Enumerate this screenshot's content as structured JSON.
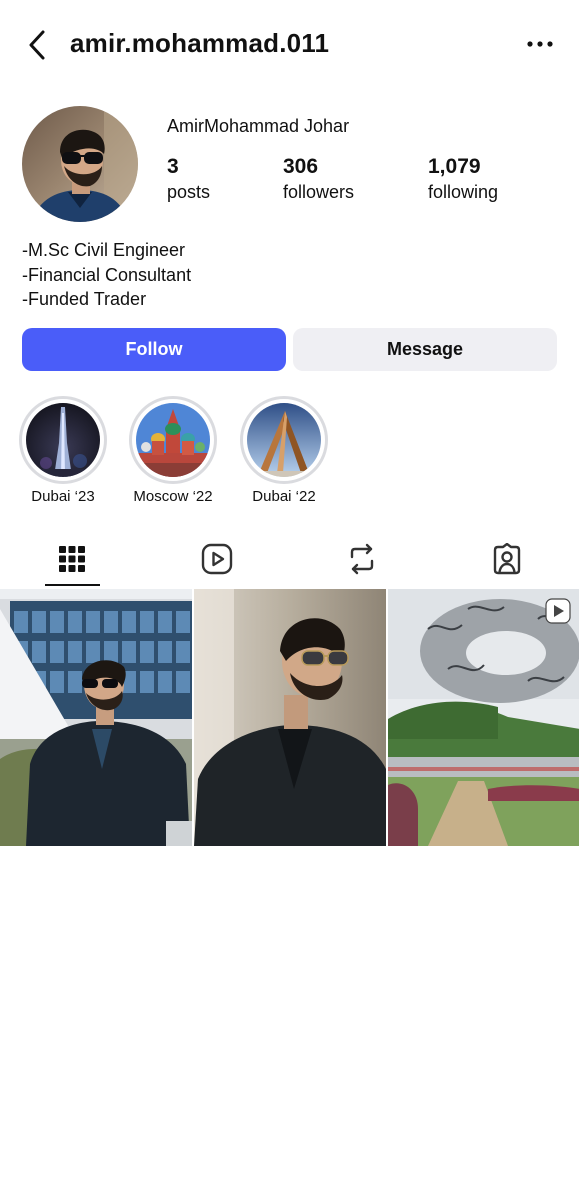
{
  "header": {
    "username": "amir.mohammad.011",
    "back_icon": "chevron-left-icon",
    "more_icon": "more-horizontal-icon"
  },
  "profile": {
    "full_name": "AmirMohammad Johar",
    "stats": [
      {
        "value": "3",
        "label": "posts"
      },
      {
        "value": "306",
        "label": "followers"
      },
      {
        "value": "1,079",
        "label": "following"
      }
    ],
    "bio": [
      "-M.Sc Civil Engineer",
      "-Financial Consultant",
      "-Funded Trader"
    ]
  },
  "actions": {
    "follow_label": "Follow",
    "message_label": "Message",
    "follow_color": "#4a5df9",
    "message_color": "#efeff3"
  },
  "highlights": [
    {
      "label": "Dubai ‘23"
    },
    {
      "label": "Moscow ‘22"
    },
    {
      "label": "Dubai ‘22"
    }
  ],
  "tabs": [
    {
      "name": "posts-grid",
      "icon": "grid-icon",
      "active": true
    },
    {
      "name": "reels",
      "icon": "reels-icon",
      "active": false
    },
    {
      "name": "reposts",
      "icon": "repost-icon",
      "active": false
    },
    {
      "name": "tagged",
      "icon": "tagged-person-icon",
      "active": false
    }
  ],
  "posts": [
    {
      "type": "photo"
    },
    {
      "type": "photo"
    },
    {
      "type": "reel",
      "badge_icon": "reel-play-icon"
    }
  ]
}
